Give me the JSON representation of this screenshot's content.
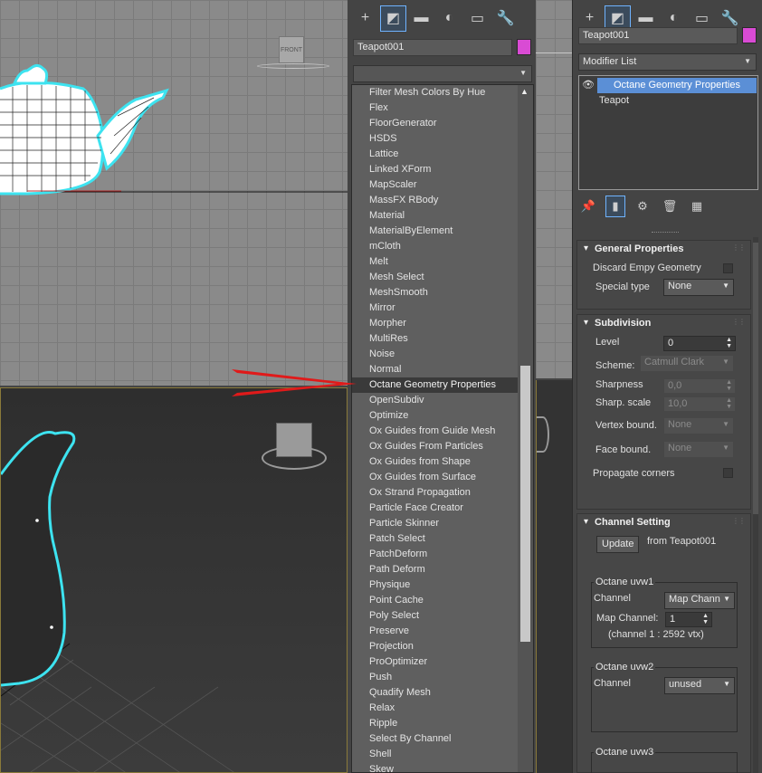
{
  "object_name": "Teapot001",
  "viewport": {
    "viewcube_front_label": "FRONT"
  },
  "left_panel": {
    "tabs": [
      "create-icon",
      "modify-icon",
      "hierarchy-icon",
      "motion-icon",
      "display-icon",
      "utilities-icon"
    ],
    "tab_glyphs": [
      "+",
      "◩",
      "▬",
      "◐",
      "▭",
      "🔧"
    ],
    "modifier_dropdown_value": "",
    "modifier_items": [
      "Filter Mesh Colors By Hue",
      "Flex",
      "FloorGenerator",
      "HSDS",
      "Lattice",
      "Linked XForm",
      "MapScaler",
      "MassFX RBody",
      "Material",
      "MaterialByElement",
      "mCloth",
      "Melt",
      "Mesh Select",
      "MeshSmooth",
      "Mirror",
      "Morpher",
      "MultiRes",
      "Noise",
      "Normal",
      "Octane Geometry Properties",
      "OpenSubdiv",
      "Optimize",
      "Ox Guides from Guide Mesh",
      "Ox Guides From Particles",
      "Ox Guides from Shape",
      "Ox Guides from Surface",
      "Ox Strand Propagation",
      "Particle Face Creator",
      "Particle Skinner",
      "Patch Select",
      "PatchDeform",
      "Path Deform",
      "Physique",
      "Point Cache",
      "Poly Select",
      "Preserve",
      "Projection",
      "ProOptimizer",
      "Push",
      "Quadify Mesh",
      "Relax",
      "Ripple",
      "Select By Channel",
      "Shell",
      "Skew"
    ],
    "selected_index": 19
  },
  "right_panel": {
    "modifier_list_label": "Modifier List",
    "stack": [
      {
        "label": "Octane Geometry Properties",
        "selected": true
      },
      {
        "label": "Teapot",
        "selected": false
      }
    ],
    "general": {
      "title": "General Properties",
      "discard_label": "Discard Empy Geometry",
      "special_type_label": "Special type",
      "special_type_value": "None"
    },
    "subdivision": {
      "title": "Subdivision",
      "level_label": "Level",
      "level_value": "0",
      "scheme_label": "Scheme:",
      "scheme_value": "Catmull Clark",
      "sharpness_label": "Sharpness",
      "sharpness_value": "0,0",
      "sharp_scale_label": "Sharp. scale",
      "sharp_scale_value": "10,0",
      "vertex_bound_label": "Vertex bound.",
      "vertex_bound_value": "None",
      "face_bound_label": "Face bound.",
      "face_bound_value": "None",
      "propagate_label": "Propagate corners"
    },
    "channel": {
      "title": "Channel Setting",
      "update_label": "Update",
      "from_text": "from Teapot001",
      "uvw1_title": "Octane uvw1",
      "uvw1_channel_label": "Channel",
      "uvw1_channel_value": "Map Chann",
      "uvw1_map_channel_label": "Map Channel:",
      "uvw1_map_channel_value": "1",
      "uvw1_info": "(channel 1 : 2592 vtx)",
      "uvw2_title": "Octane uvw2",
      "uvw2_channel_label": "Channel",
      "uvw2_channel_value": "unused",
      "uvw3_title": "Octane uvw3"
    }
  },
  "colors": {
    "object_color": "#d94bd4",
    "selection_highlight": "#5b8fd6",
    "wire_selected": "#3de3f0",
    "arrow": "#e01a1a"
  }
}
